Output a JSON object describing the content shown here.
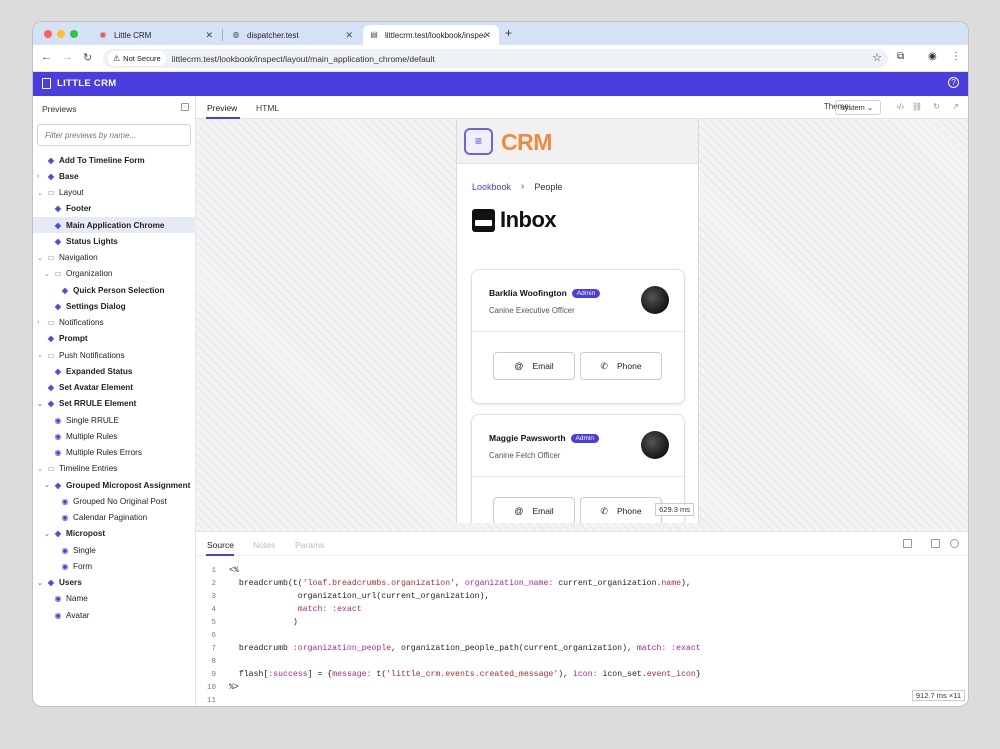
{
  "browser": {
    "tabs": [
      {
        "title": "Little CRM"
      },
      {
        "title": "dispatcher.test"
      },
      {
        "title": "littlecrm.test/lookbook/inspec"
      }
    ],
    "security_label": "Not Secure",
    "url": "littlecrm.test/lookbook/inspect/layout/main_application_chrome/default"
  },
  "app": {
    "brand": "LITTLE CRM"
  },
  "sidebar": {
    "heading": "Previews",
    "filter_placeholder": "Filter previews by name...",
    "items": [
      {
        "label": "Add To Timeline Form",
        "type": "component",
        "level": 0,
        "bold": true
      },
      {
        "label": "Base",
        "type": "component",
        "level": 0,
        "bold": true,
        "expandable": true
      },
      {
        "label": "Layout",
        "type": "folder",
        "level": 0,
        "expanded": true
      },
      {
        "label": "Footer",
        "type": "component",
        "level": 1,
        "bold": true
      },
      {
        "label": "Main Application Chrome",
        "type": "component",
        "level": 1,
        "bold": true,
        "selected": true
      },
      {
        "label": "Status Lights",
        "type": "component",
        "level": 1,
        "bold": true
      },
      {
        "label": "Navigation",
        "type": "folder",
        "level": 0,
        "expanded": true
      },
      {
        "label": "Organization",
        "type": "folder",
        "level": 1,
        "expanded": true
      },
      {
        "label": "Quick Person Selection",
        "type": "component",
        "level": 2,
        "bold": true
      },
      {
        "label": "Settings Dialog",
        "type": "component",
        "level": 1,
        "bold": true
      },
      {
        "label": "Notifications",
        "type": "folder",
        "level": 0,
        "expandable": true
      },
      {
        "label": "Prompt",
        "type": "component",
        "level": 0,
        "bold": true
      },
      {
        "label": "Push Notifications",
        "type": "folder",
        "level": 0,
        "expanded": true
      },
      {
        "label": "Expanded Status",
        "type": "component",
        "level": 1,
        "bold": true
      },
      {
        "label": "Set Avatar Element",
        "type": "component",
        "level": 0,
        "bold": true
      },
      {
        "label": "Set RRULE Element",
        "type": "component",
        "level": 0,
        "bold": true,
        "expanded": true
      },
      {
        "label": "Single RRULE",
        "type": "preview",
        "level": 1
      },
      {
        "label": "Multiple Rules",
        "type": "preview",
        "level": 1
      },
      {
        "label": "Multiple Rules Errors",
        "type": "preview",
        "level": 1
      },
      {
        "label": "Timeline Entries",
        "type": "folder",
        "level": 0,
        "expanded": true
      },
      {
        "label": "Grouped Micropost Assignment",
        "type": "component",
        "level": 1,
        "bold": true,
        "expanded": true
      },
      {
        "label": "Grouped No Original Post",
        "type": "preview",
        "level": 2
      },
      {
        "label": "Calendar Pagination",
        "type": "preview",
        "level": 2
      },
      {
        "label": "Micropost",
        "type": "component",
        "level": 1,
        "bold": true,
        "expanded": true
      },
      {
        "label": "Single",
        "type": "preview",
        "level": 2
      },
      {
        "label": "Form",
        "type": "preview",
        "level": 2
      },
      {
        "label": "Users",
        "type": "component",
        "level": 0,
        "bold": true,
        "expanded": true
      },
      {
        "label": "Name",
        "type": "preview",
        "level": 1
      },
      {
        "label": "Avatar",
        "type": "preview",
        "level": 1
      }
    ]
  },
  "main": {
    "tabs": [
      "Preview",
      "HTML"
    ],
    "theme_label": "Theme:",
    "theme_value": "system"
  },
  "preview": {
    "logo": "CRM",
    "breadcrumb": [
      "Lookbook",
      "People"
    ],
    "title": "Inbox",
    "cards": [
      {
        "name": "Barklia Woofington",
        "badge": "Admin",
        "role": "Canine Executive Officer",
        "email_label": "Email",
        "phone_label": "Phone"
      },
      {
        "name": "Maggie Pawsworth",
        "badge": "Admin",
        "role": "Canine Fetch Officer",
        "email_label": "Email",
        "phone_label": "Phone"
      }
    ],
    "timing": "629.3 ms"
  },
  "bottom": {
    "tabs": [
      "Source",
      "Notes",
      "Params"
    ],
    "timing": "912.7 ms ×11"
  },
  "source_lines": [
    [
      {
        "t": "<%",
        "c": "plain"
      }
    ],
    [
      {
        "t": "  breadcrumb(t(",
        "c": "plain"
      },
      {
        "t": "'loaf.breadcrumbs.organization'",
        "c": "str"
      },
      {
        "t": ", ",
        "c": "plain"
      },
      {
        "t": "organization_name:",
        "c": "sym"
      },
      {
        "t": " current_organization.",
        "c": "plain"
      },
      {
        "t": "name",
        "c": "str"
      },
      {
        "t": "),",
        "c": "plain"
      }
    ],
    [
      {
        "t": "              organization_url(current_organization),",
        "c": "plain"
      }
    ],
    [
      {
        "t": "              ",
        "c": "plain"
      },
      {
        "t": "match:",
        "c": "sym"
      },
      {
        "t": " ",
        "c": "plain"
      },
      {
        "t": ":exact",
        "c": "sym"
      }
    ],
    [
      {
        "t": "             )",
        "c": "plain"
      }
    ],
    [
      {
        "t": "",
        "c": "plain"
      }
    ],
    [
      {
        "t": "  breadcrumb ",
        "c": "plain"
      },
      {
        "t": ":organization_people",
        "c": "sym"
      },
      {
        "t": ", organization_people_path(current_organization), ",
        "c": "plain"
      },
      {
        "t": "match:",
        "c": "sym"
      },
      {
        "t": " ",
        "c": "plain"
      },
      {
        "t": ":exact",
        "c": "sym"
      }
    ],
    [
      {
        "t": "",
        "c": "plain"
      }
    ],
    [
      {
        "t": "  flash[",
        "c": "plain"
      },
      {
        "t": ":success",
        "c": "sym"
      },
      {
        "t": "] = {",
        "c": "plain"
      },
      {
        "t": "message:",
        "c": "sym"
      },
      {
        "t": " t(",
        "c": "plain"
      },
      {
        "t": "'little_crm.events.created_message'",
        "c": "str"
      },
      {
        "t": "), ",
        "c": "plain"
      },
      {
        "t": "icon:",
        "c": "sym"
      },
      {
        "t": " icon_set.",
        "c": "plain"
      },
      {
        "t": "event_icon",
        "c": "str"
      },
      {
        "t": "}",
        "c": "plain"
      }
    ],
    [
      {
        "t": "%>",
        "c": "plain"
      }
    ],
    [
      {
        "t": "",
        "c": "plain"
      }
    ]
  ]
}
